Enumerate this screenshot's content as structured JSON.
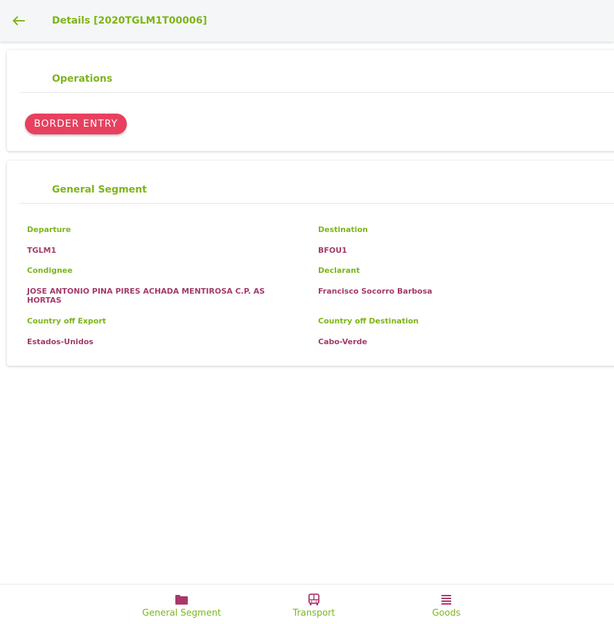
{
  "header": {
    "title": "Details [2020TGLM1T00006]",
    "back_icon": "arrow-left-icon"
  },
  "operations": {
    "title": "Operations",
    "chip_label": "BORDER ENTRY"
  },
  "general_segment": {
    "title": "General Segment",
    "departure_label": "Departure",
    "departure_value": "TGLM1",
    "destination_label": "Destination",
    "destination_value": "BFOU1",
    "consignee_label": "Condignee",
    "consignee_value": "JOSE ANTONIO PINA PIRES ACHADA MENTIROSA C.P. AS HORTAS",
    "declarant_label": "Declarant",
    "declarant_value": "Francisco Socorro Barbosa",
    "country_export_label": "Country off Export",
    "country_export_value": "Estados-Unidos",
    "country_destination_label": "Country off Destination",
    "country_destination_value": "Cabo-Verde"
  },
  "bottom_nav": {
    "items": [
      {
        "label": "General Segment",
        "icon": "folder-icon"
      },
      {
        "label": "Transport",
        "icon": "bus-icon"
      },
      {
        "label": "Goods",
        "icon": "list-icon"
      }
    ]
  },
  "colors": {
    "accent_green": "#7cb518",
    "value_magenta": "#a23a6a",
    "chip_red": "#e8405f",
    "icon_magenta": "#a8376a"
  }
}
